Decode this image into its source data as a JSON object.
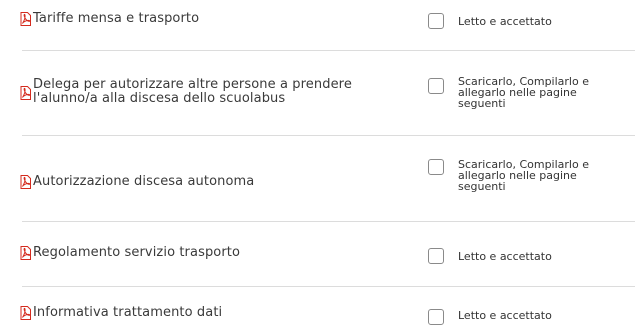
{
  "documents": [
    {
      "title": "Tariffe mensa e trasporto",
      "checkbox_label": "Letto e accettato",
      "icon": "pdf-icon"
    },
    {
      "title": "Delega per autorizzare altre persone a prendere l'alunno/a alla discesa dello scuolabus",
      "checkbox_label": "Scaricarlo, Compilarlo e allegarlo nelle pagine seguenti",
      "icon": "pdf-icon"
    },
    {
      "title": "Autorizzazione discesa autonoma",
      "checkbox_label": "Scaricarlo, Compilarlo e allegarlo nelle pagine seguenti",
      "icon": "pdf-icon"
    },
    {
      "title": "Regolamento servizio trasporto",
      "checkbox_label": "Letto e accettato",
      "icon": "pdf-icon"
    },
    {
      "title": "Informativa trattamento dati",
      "checkbox_label": "Letto e accettato",
      "icon": "pdf-icon"
    }
  ],
  "colors": {
    "pdf_red": "#d42b1e",
    "divider": "#dcdcdc",
    "text": "#3a3a3a"
  }
}
